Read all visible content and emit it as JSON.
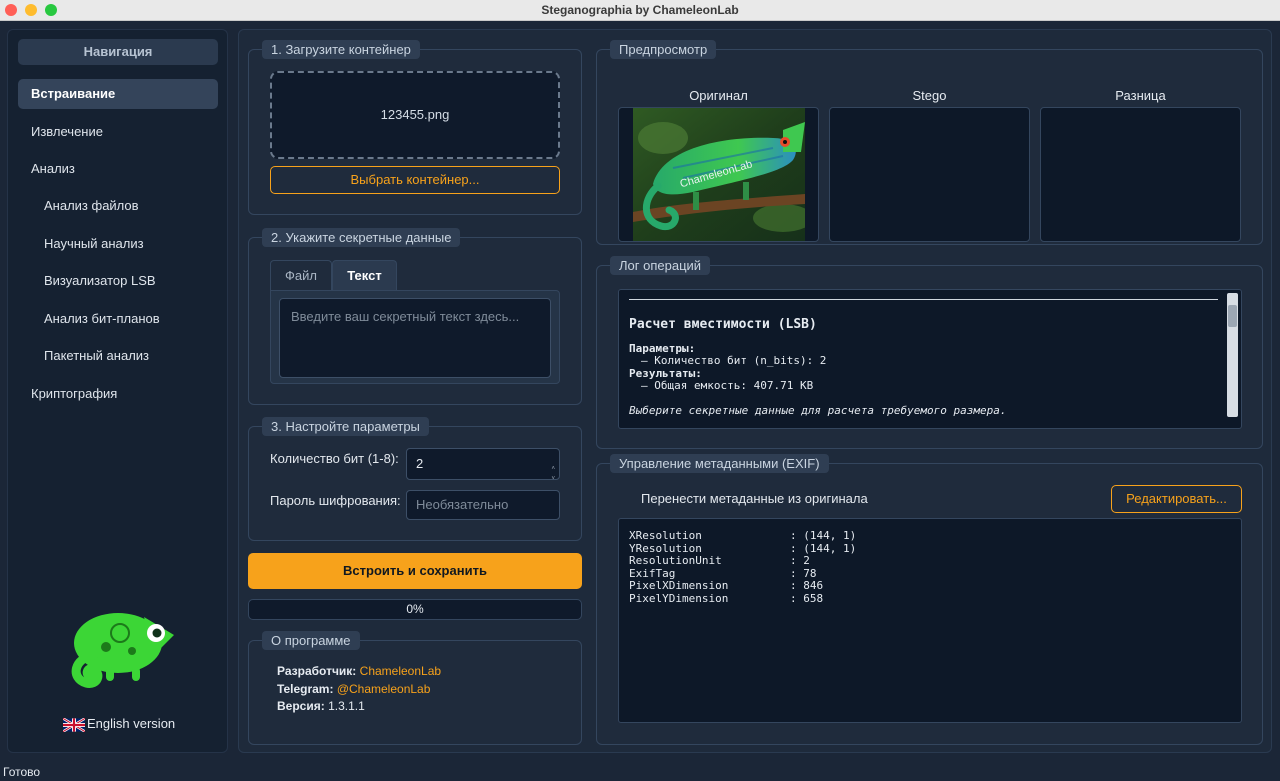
{
  "window": {
    "title": "Steganographia by ChameleonLab"
  },
  "sidebar": {
    "header": "Навигация",
    "items": [
      {
        "label": "Встраивание"
      },
      {
        "label": "Извлечение"
      },
      {
        "label": "Анализ"
      },
      {
        "label": "Анализ файлов"
      },
      {
        "label": "Научный анализ"
      },
      {
        "label": "Визуализатор LSB"
      },
      {
        "label": "Анализ бит-планов"
      },
      {
        "label": "Пакетный анализ"
      },
      {
        "label": "Криптография"
      }
    ],
    "logo_icon": "chameleon-logo-icon",
    "language": {
      "label": "English version",
      "icon": "uk-flag-icon"
    }
  },
  "container": {
    "title": "1. Загрузите контейнер",
    "filename": "123455.png",
    "choose_label": "Выбрать контейнер..."
  },
  "secret": {
    "title": "2. Укажите секретные данные",
    "tab_file": "Файл",
    "tab_text": "Текст",
    "placeholder": "Введите ваш секретный текст здесь..."
  },
  "params": {
    "title": "3. Настройте параметры",
    "bits_label": "Количество бит (1-8):",
    "bits_value": "2",
    "password_label": "Пароль шифрования:",
    "password_placeholder": "Необязательно"
  },
  "actions": {
    "embed_label": "Встроить и сохранить",
    "progress_text": "0%",
    "progress": 0
  },
  "about": {
    "title": "О программе",
    "developer_label": "Разработчик:",
    "developer_value": "ChameleonLab",
    "telegram_label": "Telegram:",
    "telegram_value": "@ChameleonLab",
    "version_label": "Версия:",
    "version_value": "1.3.1.1"
  },
  "preview": {
    "title": "Предпросмотр",
    "original": "Оригинал",
    "stego": "Stego",
    "diff": "Разница",
    "image_watermark": "ChameleonLab"
  },
  "log": {
    "title": "Лог операций",
    "heading": "Расчет вместимости (LSB)",
    "params_label": "Параметры:",
    "params_line": "– Количество бит (n_bits): 2",
    "results_label": "Результаты:",
    "results_line": "– Общая емкость: 407.71 KB",
    "hint": "Выберите секретные данные для расчета требуемого размера."
  },
  "exif": {
    "title": "Управление метаданными (EXIF)",
    "transfer_label": "Перенести метаданные из оригинала",
    "edit_label": "Редактировать...",
    "rows": [
      {
        "key": "XResolution",
        "value": ": (144, 1)"
      },
      {
        "key": "YResolution",
        "value": ": (144, 1)"
      },
      {
        "key": "ResolutionUnit",
        "value": ": 2"
      },
      {
        "key": "ExifTag",
        "value": ": 78"
      },
      {
        "key": "PixelXDimension",
        "value": ": 846"
      },
      {
        "key": "PixelYDimension",
        "value": ": 658"
      }
    ]
  },
  "status": {
    "text": "Готово"
  },
  "colors": {
    "accent": "#f7a21b",
    "background": "#1b2637",
    "panel": "#1f2b3c",
    "well": "#0f1a2b"
  }
}
